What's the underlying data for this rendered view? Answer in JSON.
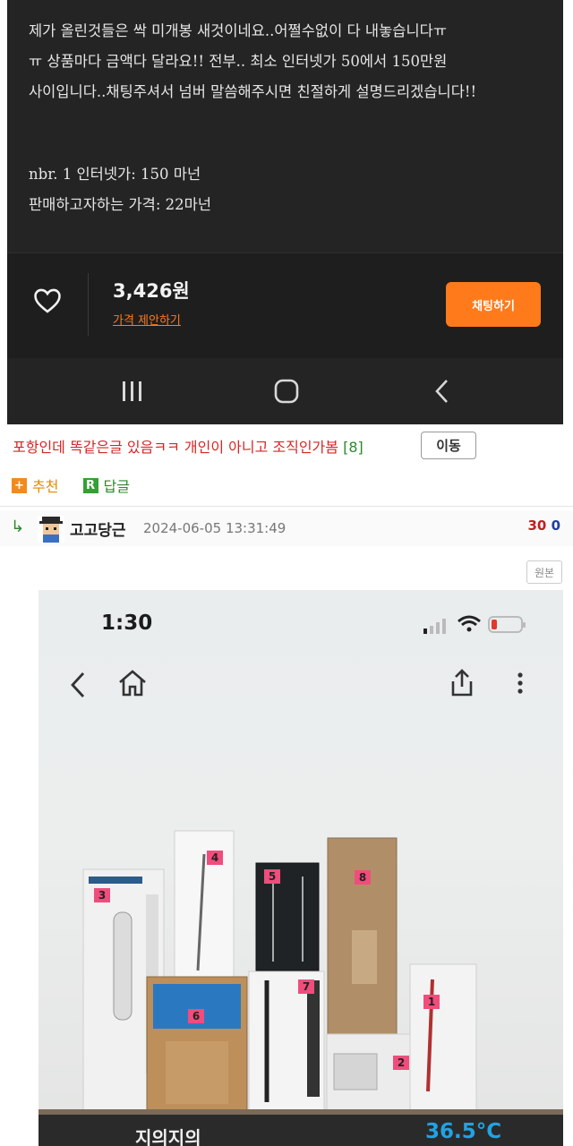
{
  "post": {
    "lines": [
      "제가 올린것들은 싹 미개봉 새것이네요..어쩔수없이 다 내놓습니다ㅠ",
      "ㅠ 상품마다 금액다 달라요!! 전부.. 최소 인터넷가 50에서 150만원",
      "사이입니다..채팅주셔서 넘버 말씀해주시면 친절하게 설명드리겠습니다!!",
      "nbr. 1 인터넷가: 150 마넌",
      "판매하고자하는 가격: 22마넌"
    ]
  },
  "buy_bar": {
    "price": "3,426원",
    "offer_label": "가격 제안하기",
    "chat_label": "채팅하기"
  },
  "icons": {
    "heart": "heart-icon",
    "recent_apps": "recent-apps-icon",
    "home": "home-circle-icon",
    "back": "back-chevron-icon"
  },
  "comment": {
    "text": "포항인데 똑같은글 있음ㅋㅋ 개인이 아니고 조직인가봄",
    "count": "[8]",
    "move_label": "이동",
    "recommend_label": "추천",
    "recommend_icon": "+",
    "reply_label": "답글",
    "reply_icon": "R"
  },
  "reply": {
    "arrow": "↳",
    "nickname": "고고당근",
    "datetime": "2024-06-05 13:31:49",
    "up": "30",
    "down": "0",
    "original_label": "원본"
  },
  "screenshot": {
    "time": "1:30",
    "tags": [
      "1",
      "2",
      "3",
      "4",
      "5",
      "6",
      "7",
      "8"
    ],
    "seller_name": "지의지의",
    "temperature": "36.5°C"
  },
  "colors": {
    "accent": "#ff7a1a",
    "dark_bg": "#242424",
    "comment_red": "#d62525",
    "count_green": "#2c8a2c",
    "temp_blue": "#21a3e3",
    "tag_pink": "#f04d7c"
  }
}
